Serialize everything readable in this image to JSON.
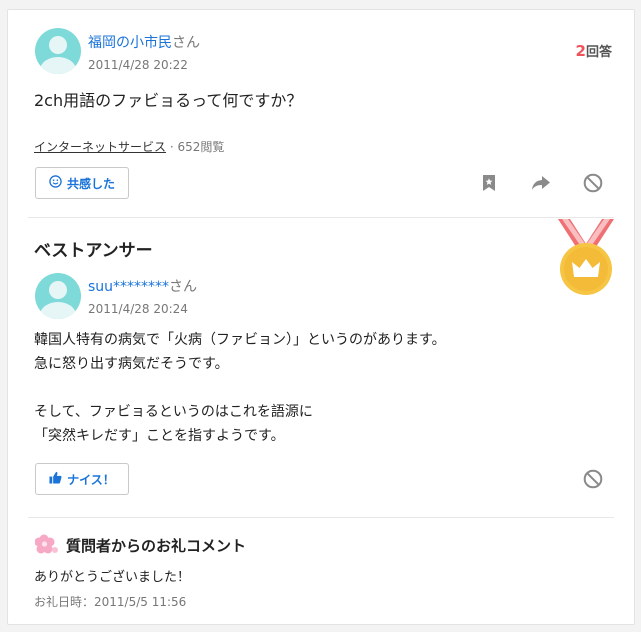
{
  "question": {
    "user_name": "福岡の小市民",
    "user_suffix": "さん",
    "date": "2011/4/28 20:22",
    "answer_count": "2",
    "answer_count_label": "回答",
    "text": "2ch用語のファビョるって何ですか？",
    "category": "インターネットサービス",
    "views": "· 652閲覧",
    "empathy_label": "共感した"
  },
  "best_answer": {
    "title": "ベストアンサー",
    "user_name": "suu********",
    "user_suffix": "さん",
    "date": "2011/4/28 20:24",
    "text": "韓国人特有の病気で「火病（ファビョン）」というのがあります。\n急に怒り出す病気だそうです。\n\nそして、ファビョるというのはこれを語源に\n「突然キレだす」ことを指すようです。",
    "nice_label": "ナイス！"
  },
  "thanks": {
    "title": "質問者からのお礼コメント",
    "comment": "ありがとうございました！",
    "date": "お礼日時：2011/5/5 11:56"
  },
  "colors": {
    "link": "#1a73d9",
    "accent_red": "#f0525a",
    "avatar": "#7ed9d9",
    "medal_gold": "#f6c544"
  },
  "icons": [
    "smile-icon",
    "bookmark-icon",
    "share-icon",
    "block-icon",
    "thumbs-up-icon",
    "crown-medal-icon",
    "flower-icon"
  ]
}
